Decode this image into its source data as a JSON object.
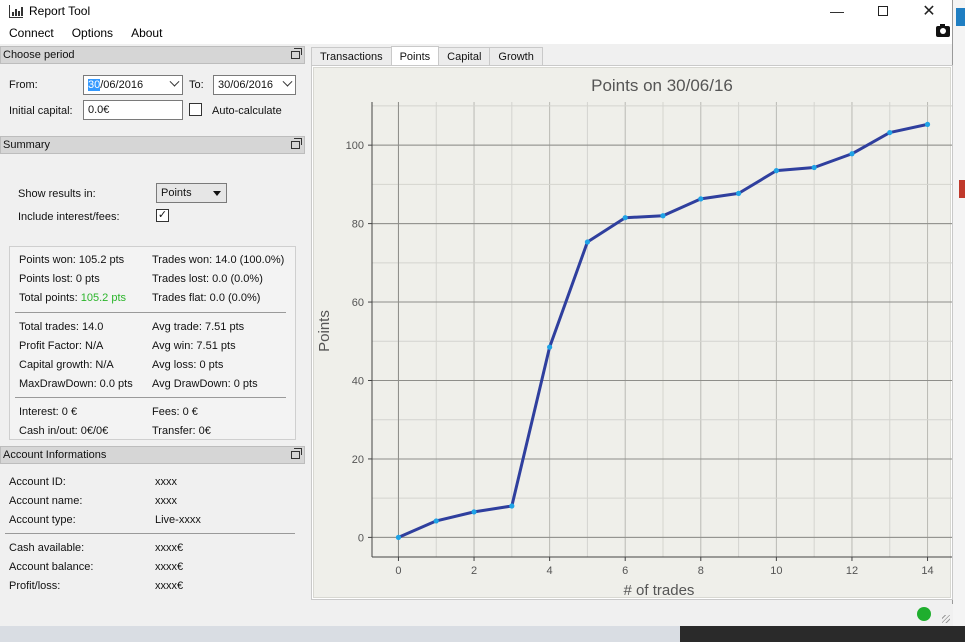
{
  "window": {
    "title": "Report Tool"
  },
  "menu": [
    "Connect",
    "Options",
    "About"
  ],
  "period": {
    "header": "Choose period",
    "from_label": "From:",
    "from_value_selected": "30",
    "from_value_rest": "/06/2016",
    "to_label": "To:",
    "to_value": "30/06/2016",
    "capital_label": "Initial capital:",
    "capital_value": "0.0€",
    "autocalc_label": "Auto-calculate"
  },
  "summary": {
    "header": "Summary",
    "show_results_label": "Show results in:",
    "show_results_value": "Points",
    "include_label": "Include interest/fees:",
    "include_checked": "✓",
    "points_won": "Points won: 105.2 pts",
    "points_lost": "Points lost: 0 pts",
    "total_points_label": "Total points: ",
    "total_points_value": "105.2 pts",
    "trades_won": "Trades won: 14.0 (100.0%)",
    "trades_lost": "Trades lost: 0.0 (0.0%)",
    "trades_flat": "Trades flat: 0.0 (0.0%)",
    "total_trades": "Total trades: 14.0",
    "profit_factor": "Profit Factor: N/A",
    "capital_growth": "Capital growth: N/A",
    "max_drawdown": "MaxDrawDown: 0.0 pts",
    "avg_trade": "Avg trade: 7.51 pts",
    "avg_win": "Avg win: 7.51 pts",
    "avg_loss": "Avg loss: 0 pts",
    "avg_drawdown": "Avg DrawDown: 0 pts",
    "interest": "Interest: 0 €",
    "cash": "Cash in/out: 0€/0€",
    "fees": "Fees: 0 €",
    "transfer": "Transfer: 0€"
  },
  "account": {
    "header": "Account Informations",
    "rows1": [
      {
        "label": "Account ID:",
        "value": "xxxx"
      },
      {
        "label": "Account name:",
        "value": "xxxx"
      },
      {
        "label": "Account type:",
        "value": "Live-xxxx"
      }
    ],
    "rows2": [
      {
        "label": "Cash available:",
        "value": "xxxx€"
      },
      {
        "label": "Account balance:",
        "value": "xxxx€"
      },
      {
        "label": "Profit/loss:",
        "value": "xxxx€"
      }
    ]
  },
  "tabs": [
    "Transactions",
    "Points",
    "Capital",
    "Growth"
  ],
  "active_tab": "Points",
  "colors": {
    "line": "#2f3f9e",
    "point": "#1fa3e6",
    "status_ok": "#1fae2e"
  },
  "chart_data": {
    "type": "line",
    "title": "Points on 30/06/16",
    "xlabel": "# of trades",
    "ylabel": "Points",
    "xlim": [
      -0.7,
      14.7
    ],
    "ylim": [
      -5,
      111
    ],
    "xticks": [
      0,
      2,
      4,
      6,
      8,
      10,
      12,
      14
    ],
    "yticks": [
      0,
      20,
      40,
      60,
      80,
      100
    ],
    "grid": true,
    "x": [
      0,
      1,
      2,
      3,
      4,
      5,
      6,
      7,
      8,
      9,
      10,
      11,
      12,
      13,
      14
    ],
    "values": [
      0,
      4.2,
      6.5,
      8,
      48.5,
      75.3,
      81.5,
      82,
      86.3,
      87.7,
      93.5,
      94.3,
      97.8,
      103.2,
      105.3
    ]
  }
}
